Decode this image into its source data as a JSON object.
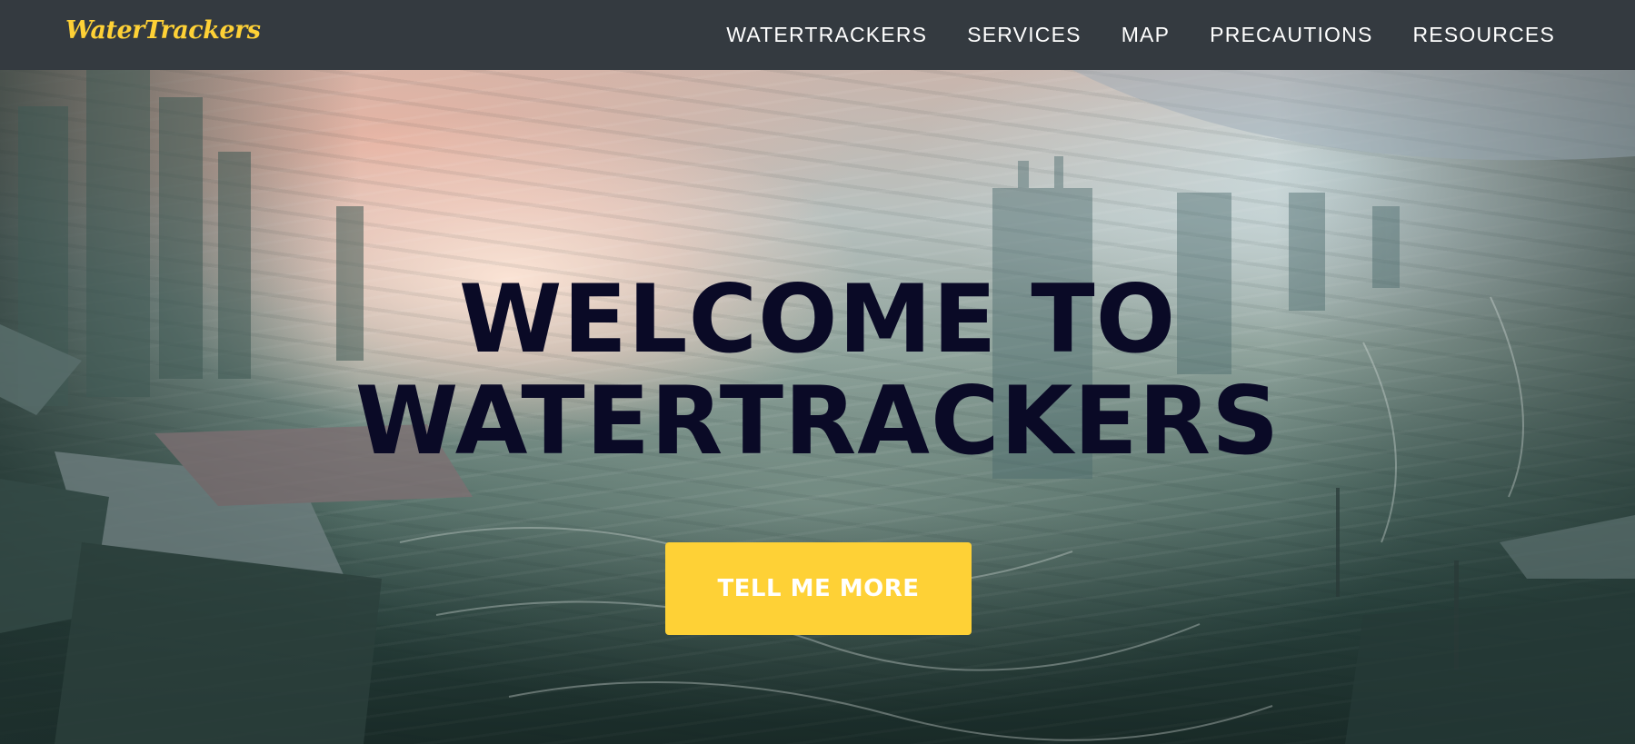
{
  "navbar": {
    "brand": "WaterTrackers",
    "links": [
      {
        "label": "WATERTRACKERS"
      },
      {
        "label": "SERVICES"
      },
      {
        "label": "MAP"
      },
      {
        "label": "PRECAUTIONS"
      },
      {
        "label": "RESOURCES"
      }
    ]
  },
  "hero": {
    "title_line1": "WELCOME TO",
    "title_line2": "WATERTRACKERS",
    "cta_label": "TELL ME MORE"
  },
  "colors": {
    "navbar_bg": "#343a40",
    "brand": "#fed136",
    "nav_text": "#ffffff",
    "hero_title": "#0a0a26",
    "cta_bg": "#fed136",
    "cta_text": "#ffffff"
  }
}
